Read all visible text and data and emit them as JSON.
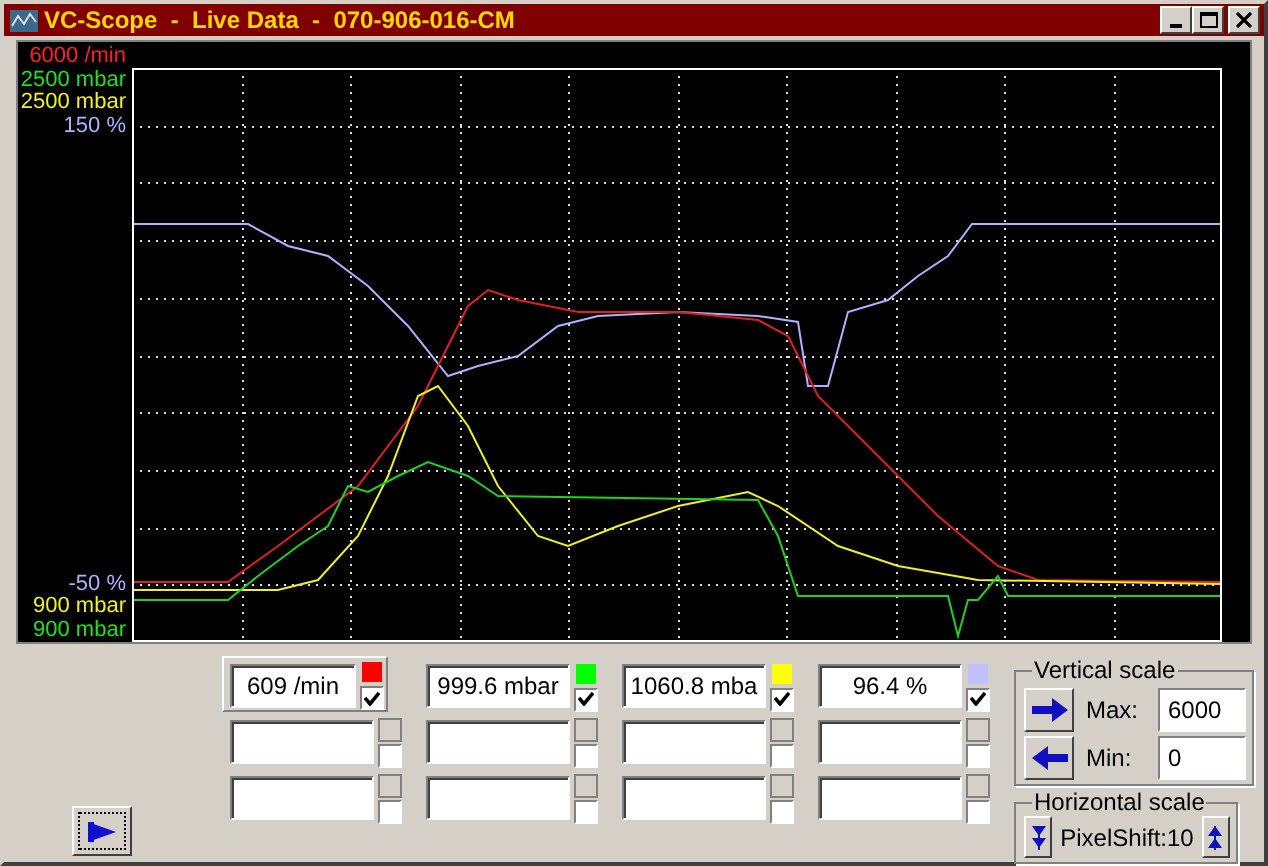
{
  "window": {
    "title": "VC-Scope  -  Live Data  -  070-906-016-CM"
  },
  "scope": {
    "top_labels": [
      {
        "text": "6000 /min",
        "color": "#ff2020"
      },
      {
        "text": "2500 mbar",
        "color": "#20e020"
      },
      {
        "text": "2500 mbar",
        "color": "#f0f020"
      },
      {
        "text": "150 %",
        "color": "#b0b0ff"
      }
    ],
    "bottom_labels": [
      {
        "text": "-50 %",
        "color": "#b0b0ff"
      },
      {
        "text": "900 mbar",
        "color": "#f0f020"
      },
      {
        "text": "900 mbar",
        "color": "#20e020"
      }
    ]
  },
  "channel_rows": [
    [
      {
        "value": "609 /min",
        "color": "#ff0000",
        "checked": true,
        "selected": true
      },
      {
        "value": "999.6 mbar",
        "color": "#00ff00",
        "checked": true,
        "selected": false
      },
      {
        "value": "1060.8 mba",
        "color": "#ffff00",
        "checked": true,
        "selected": false
      },
      {
        "value": "96.4 %",
        "color": "#c0c0ff",
        "checked": true,
        "selected": false
      }
    ],
    [
      {
        "checked": false,
        "selected": false
      },
      {
        "checked": false,
        "selected": false
      },
      {
        "checked": false,
        "selected": false
      },
      {
        "checked": false,
        "selected": false
      }
    ],
    [
      {
        "checked": false,
        "selected": false
      },
      {
        "checked": false,
        "selected": false
      },
      {
        "checked": false,
        "selected": false
      },
      {
        "checked": false,
        "selected": false
      }
    ]
  ],
  "vertical_scale": {
    "legend": "Vertical scale",
    "max_label": "Max:",
    "max": "6000",
    "min_label": "Min:",
    "min": "0"
  },
  "horizontal_scale": {
    "legend": "Horizontal scale",
    "value": "PixelShift:10"
  }
}
